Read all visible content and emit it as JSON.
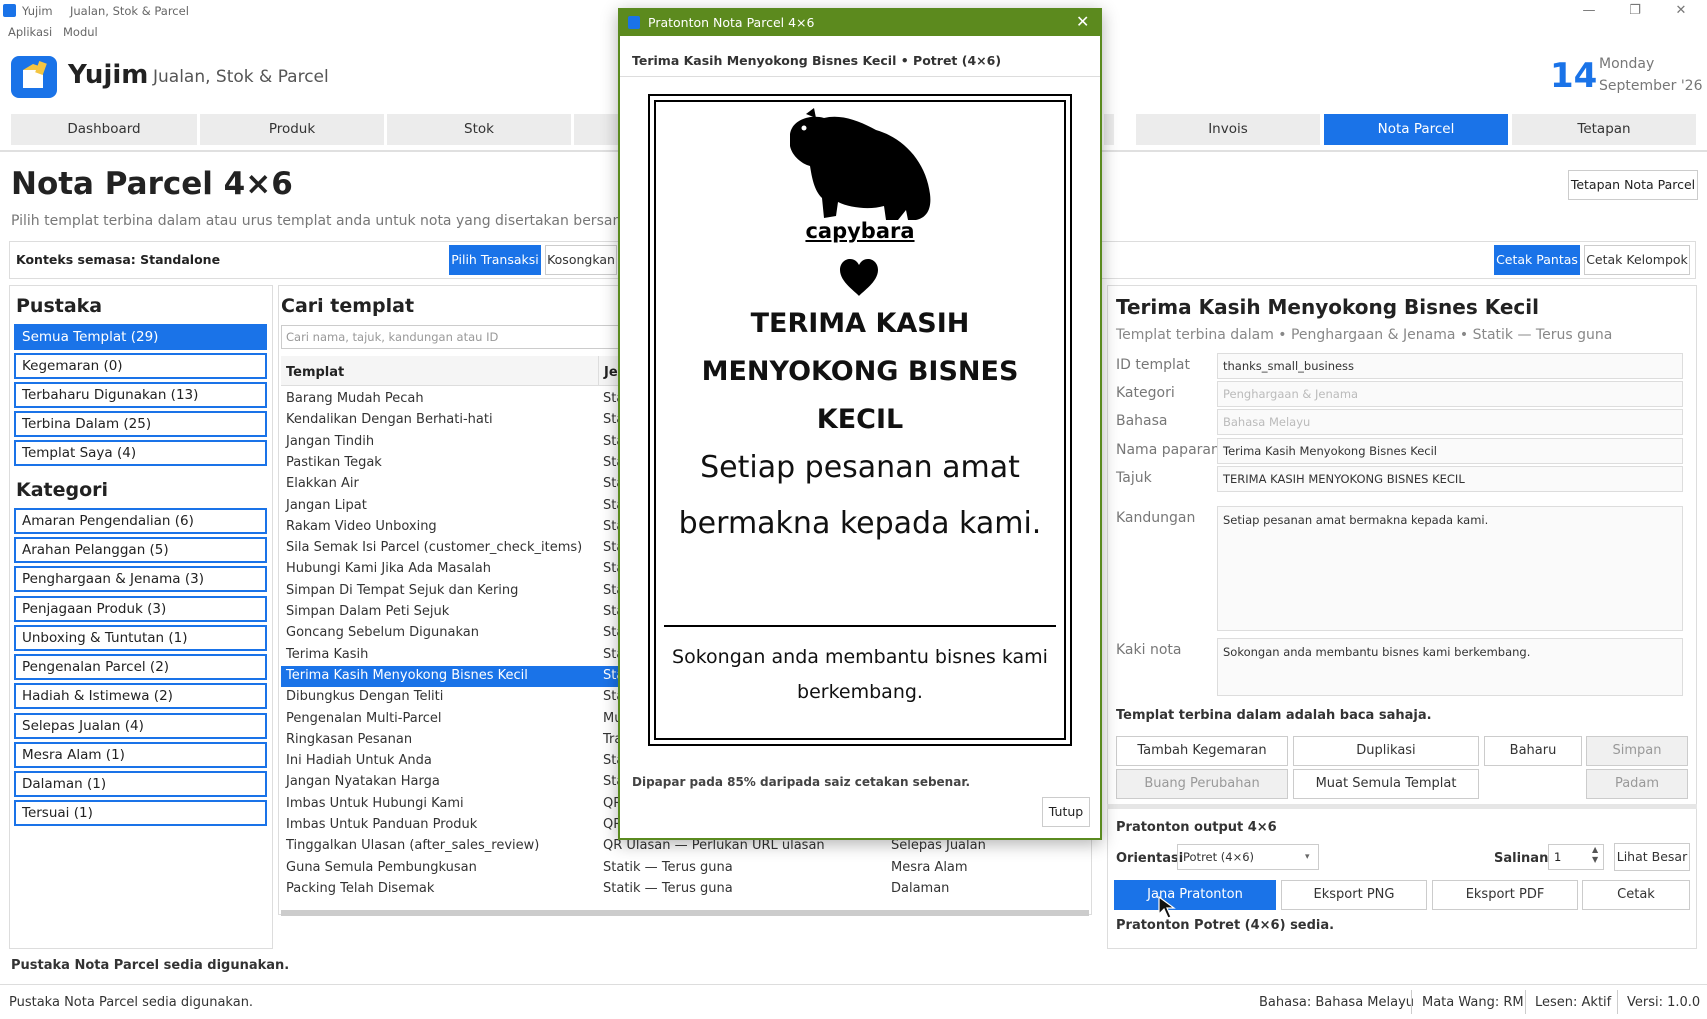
{
  "titlebar": {
    "app": "Yujim",
    "subtitle": "Jualan, Stok & Parcel",
    "min": "—",
    "max": "❐",
    "close": "✕"
  },
  "menubar": {
    "items": [
      "Aplikasi",
      "Modul"
    ]
  },
  "header": {
    "logo_glyph": "⬛",
    "brand": "Yujim",
    "tagline": "Jualan, Stok & Parcel",
    "day": "14",
    "weekday": "Monday",
    "month": "September '26"
  },
  "tabs": [
    "Dashboard",
    "Produk",
    "Stok",
    "Invois",
    "Nota Parcel",
    "Tetapan"
  ],
  "page": {
    "title": "Nota Parcel 4×6",
    "subtitle": "Pilih templat terbina dalam atau urus templat anda untuk nota yang disertakan bersama parcel.",
    "settings_button": "Tetapan Nota Parcel"
  },
  "context": {
    "label": "Konteks semasa: Standalone",
    "pick": "Pilih Transaksi",
    "clear": "Kosongkan",
    "print_fast": "Cetak Pantas",
    "print_batch": "Cetak Kelompok"
  },
  "library": {
    "heading": "Pustaka",
    "items": [
      "Semua Templat (29)",
      "Kegemaran (0)",
      "Terbaharu Digunakan (13)",
      "Terbina Dalam (25)",
      "Templat Saya (4)"
    ],
    "cat_heading": "Kategori",
    "categories": [
      "Amaran Pengendalian (6)",
      "Arahan Pelanggan (5)",
      "Penghargaan & Jenama (3)",
      "Penjagaan Produk (3)",
      "Unboxing & Tuntutan (1)",
      "Pengenalan Parcel (2)",
      "Hadiah & Istimewa (2)",
      "Selepas Jualan (4)",
      "Mesra Alam (1)",
      "Dalaman (1)",
      "Tersuai (1)"
    ]
  },
  "search": {
    "heading": "Cari templat",
    "placeholder": "Cari nama, tajuk, kandungan atau ID"
  },
  "table": {
    "headers": [
      "Templat",
      "Je"
    ],
    "rows": [
      [
        "Barang Mudah Pecah",
        "Sta",
        ""
      ],
      [
        "Kendalikan Dengan Berhati-hati",
        "Sta",
        ""
      ],
      [
        "Jangan Tindih",
        "Sta",
        ""
      ],
      [
        "Pastikan Tegak",
        "Sta",
        ""
      ],
      [
        "Elakkan Air",
        "Sta",
        ""
      ],
      [
        "Jangan Lipat",
        "Sta",
        ""
      ],
      [
        "Rakam Video Unboxing",
        "Sta",
        ""
      ],
      [
        "Sila Semak Isi Parcel  (customer_check_items)",
        "Sta",
        ""
      ],
      [
        "Hubungi Kami Jika Ada Masalah",
        "Sta",
        ""
      ],
      [
        "Simpan Di Tempat Sejuk dan Kering",
        "Sta",
        ""
      ],
      [
        "Simpan Dalam Peti Sejuk",
        "Sta",
        ""
      ],
      [
        "Goncang Sebelum Digunakan",
        "Sta",
        ""
      ],
      [
        "Terima Kasih",
        "Sta",
        ""
      ],
      [
        "Terima Kasih Menyokong Bisnes Kecil",
        "Sta",
        ""
      ],
      [
        "Dibungkus Dengan Teliti",
        "Sta",
        ""
      ],
      [
        "Pengenalan Multi-Parcel",
        "Mu",
        ""
      ],
      [
        "Ringkasan Pesanan",
        "Tra",
        ""
      ],
      [
        "Ini Hadiah Untuk Anda",
        "Sta",
        ""
      ],
      [
        "Jangan Nyatakan Harga",
        "Sta",
        ""
      ],
      [
        "Imbas Untuk Hubungi Kami",
        "QR",
        ""
      ],
      [
        "Imbas Untuk Panduan Produk",
        "QR",
        ""
      ],
      [
        "Tinggalkan Ulasan  (after_sales_review)",
        "QR Ulasan — Perlukan URL ulasan",
        "Selepas Jualan"
      ],
      [
        "Guna Semula Pembungkusan",
        "Statik — Terus guna",
        "Mesra Alam"
      ],
      [
        "Packing Telah Disemak",
        "Statik — Terus guna",
        "Dalaman"
      ]
    ],
    "selected_index": 13
  },
  "detail": {
    "title": "Terima Kasih Menyokong Bisnes Kecil",
    "subtitle": "Templat terbina dalam  •  Penghargaan & Jenama  •  Statik — Terus guna",
    "labels": {
      "id": "ID templat",
      "category": "Kategori",
      "language": "Bahasa",
      "display_name": "Nama paparan",
      "heading": "Tajuk",
      "content": "Kandungan",
      "footer": "Kaki nota"
    },
    "values": {
      "id": "thanks_small_business",
      "category": "Penghargaan & Jenama",
      "language": "Bahasa Melayu",
      "display_name": "Terima Kasih Menyokong Bisnes Kecil",
      "heading": "TERIMA KASIH MENYOKONG BISNES KECIL",
      "content": "Setiap pesanan amat bermakna kepada kami.",
      "footer": "Sokongan anda membantu bisnes kami berkembang."
    },
    "readonly_note": "Templat terbina dalam adalah baca sahaja.",
    "buttons": {
      "fav": "Tambah Kegemaran",
      "dup": "Duplikasi",
      "new": "Baharu",
      "save": "Simpan",
      "discard": "Buang Perubahan",
      "reload": "Muat Semula Templat",
      "delete": "Padam"
    }
  },
  "output": {
    "heading": "Pratonton output 4×6",
    "orientation_label": "Orientasi",
    "orientation_value": "Potret (4×6)",
    "copies_label": "Salinan",
    "copies_value": "1",
    "big": "Lihat Besar",
    "generate": "Jana Pratonton",
    "png": "Eksport PNG",
    "pdf": "Eksport PDF",
    "print": "Cetak",
    "ready": "Pratonton Potret (4×6) sedia."
  },
  "status": {
    "main": "Pustaka Nota Parcel sedia digunakan.",
    "bottom": "Pustaka Nota Parcel sedia digunakan.",
    "lang": "Bahasa: Bahasa Melayu",
    "currency": "Mata Wang: RM",
    "license": "Lesen: Aktif",
    "version": "Versi: 1.0.0"
  },
  "dialog": {
    "title": "Pratonton Nota Parcel 4×6",
    "close": "✕",
    "header": "Terima Kasih Menyokong Bisnes Kecil  •  Potret (4×6)",
    "logo_text": "capybara",
    "heading_line1": "TERIMA KASIH",
    "heading_line2": "MENYOKONG BISNES KECIL",
    "body_line1": "Setiap pesanan amat",
    "body_line2": "bermakna kepada kami.",
    "footer_line1": "Sokongan anda membantu bisnes kami",
    "footer_line2": "berkembang.",
    "note": "Dipapar pada 85% daripada saiz cetakan sebenar.",
    "close_button": "Tutup"
  },
  "colors": {
    "accent": "#1a73e8",
    "dialog_bar": "#5c8a1e"
  }
}
